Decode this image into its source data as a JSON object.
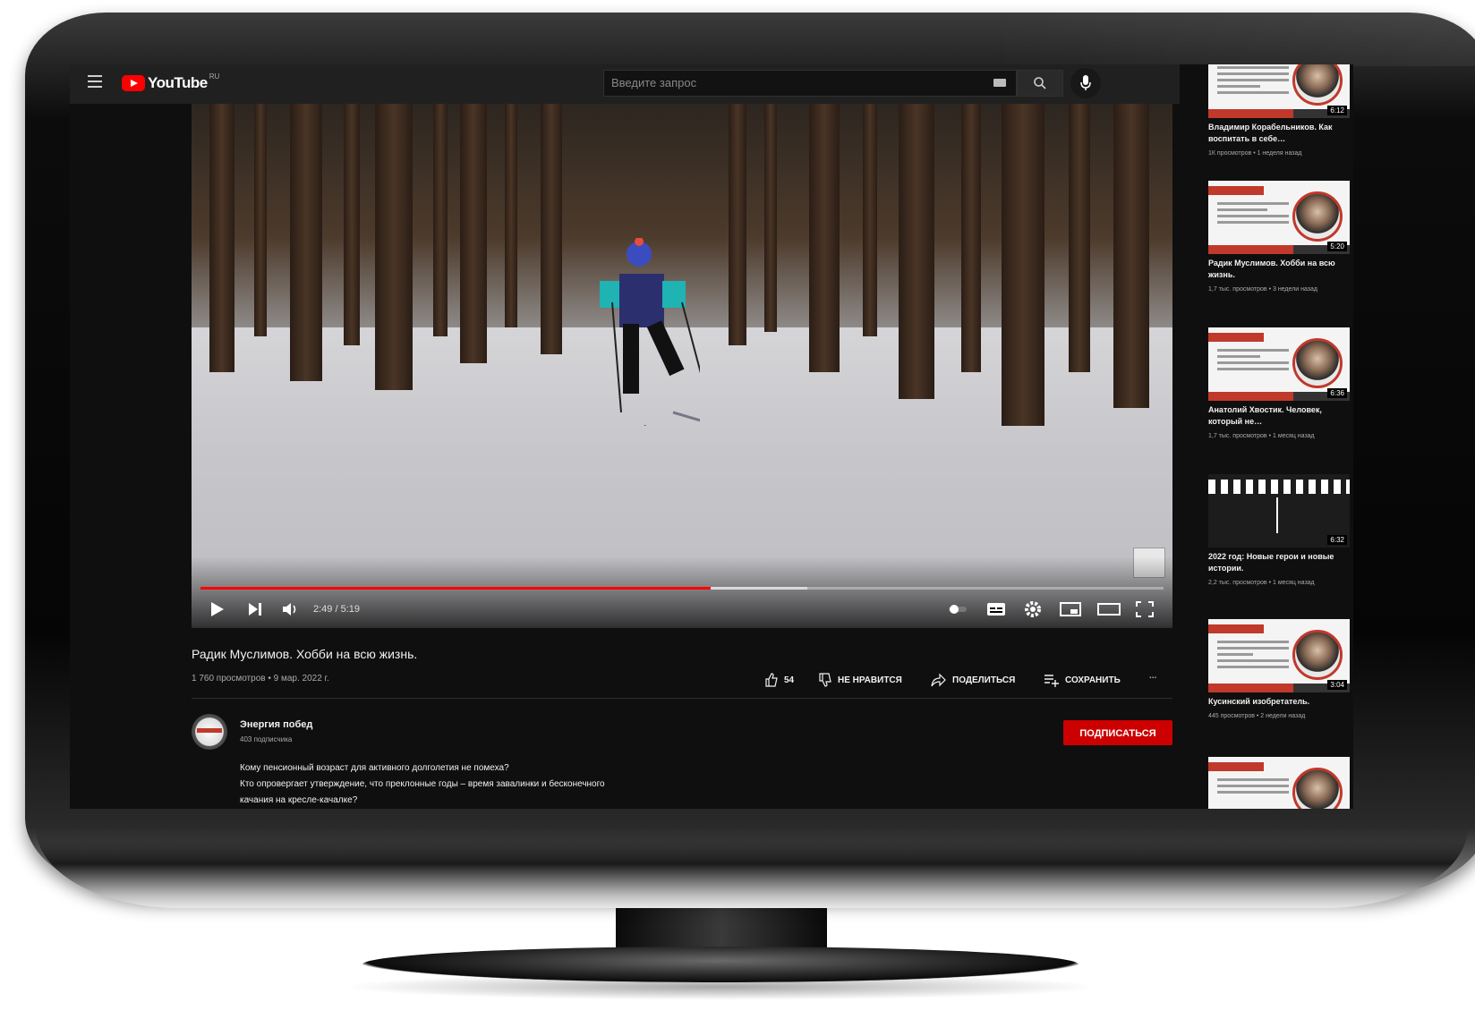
{
  "masthead": {
    "logo_text": "YouTube",
    "logo_region": "RU",
    "search_placeholder": "Введите запрос"
  },
  "player": {
    "time": "2:49 / 5:19",
    "progress_fraction": 0.53,
    "buffered_fraction": 0.63
  },
  "video": {
    "title": "Радик Муслимов. Хобби на всю жизнь.",
    "meta": "1 760 просмотров • 9 мар. 2022 г.",
    "likes": "54",
    "dislike_label": "НЕ НРАВИТСЯ",
    "share_label": "ПОДЕЛИТЬСЯ",
    "save_label": "СОХРАНИТЬ",
    "more_label": "..."
  },
  "channel": {
    "name": "Энергия побед",
    "subscribers": "403 подписчика",
    "subscribe_label": "ПОДПИСАТЬСЯ"
  },
  "description": {
    "line1": "Кому пенсионный возраст для активного долголетия не помеха?",
    "line2": "Кто опровергает утверждение, что преклонные годы – время завалинки и бесконечного",
    "line3": "качания на кресле-качалке?"
  },
  "sidebar": {
    "items": [
      {
        "title": "Владимир Корабельников. Как воспитать в себе…",
        "meta": "1К просмотров • 1 неделя назад",
        "duration": "6:12"
      },
      {
        "title": "Радик Муслимов. Хобби на всю жизнь.",
        "meta": "1,7 тыс. просмотров • 3 недели назад",
        "duration": "5:20"
      },
      {
        "title": "Анатолий Хвостик. Человек, который не…",
        "meta": "1,7 тыс. просмотров • 1 месяц назад",
        "duration": "6:36"
      },
      {
        "title": "2022 год: Новые герои и новые истории.",
        "meta": "2,2 тыс. просмотров • 1 месяц назад",
        "duration": "6:32"
      },
      {
        "title": "Кусинский изобретатель.",
        "meta": "445 просмотров • 2 недели назад",
        "duration": "3:04"
      }
    ]
  },
  "colors": {
    "accent": "#ff0000",
    "subscribe": "#cc0000",
    "background": "#0f0f0f",
    "masthead": "#202020"
  }
}
